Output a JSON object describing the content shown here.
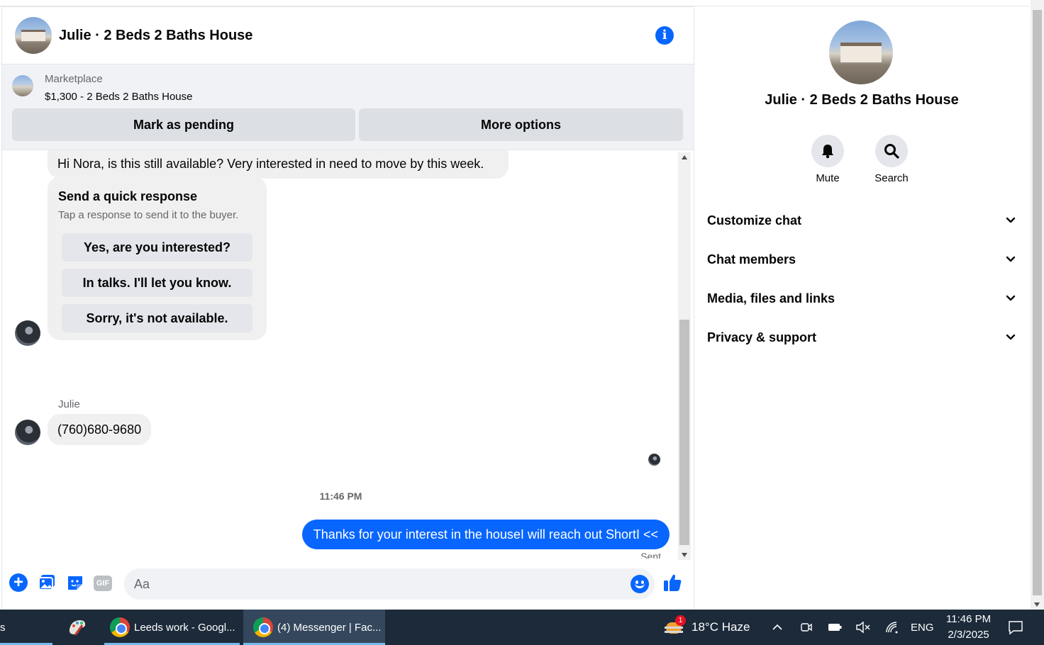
{
  "chat": {
    "title": "Julie · 2 Beds 2 Baths House",
    "marketplace_label": "Marketplace",
    "listing": "$1,300 - 2 Beds 2 Baths House",
    "mark_pending": "Mark as pending",
    "more_options": "More options"
  },
  "messages": {
    "first": "Hi Nora, is this still available? Very interested in need to move by this week.",
    "quick_title": "Send a quick response",
    "quick_sub": "Tap a response to send it to the buyer.",
    "quick_options": [
      "Yes, are you interested?",
      "In talks. I'll let you know.",
      "Sorry, it's not available."
    ],
    "sender": "Julie",
    "phone": "(760)680-9680",
    "timestamp": "11:46 PM",
    "sent_text": "Thanks for your interest in the houseI will reach out ShortI <<",
    "sent_status": "Sent"
  },
  "composer": {
    "placeholder": "Aa",
    "gif": "GIF"
  },
  "side": {
    "title": "Julie · 2 Beds 2 Baths House",
    "mute": "Mute",
    "search": "Search",
    "sections": [
      "Customize chat",
      "Chat members",
      "Media, files and links",
      "Privacy & support"
    ]
  },
  "taskbar": {
    "partial_label": "s",
    "leeds_label": "Leeds work - Googl...",
    "messenger_label": "(4) Messenger | Fac...",
    "weather_badge": "1",
    "weather": "18°C  Haze",
    "lang": "ENG",
    "time": "11:46 PM",
    "date": "2/3/2025"
  },
  "colors": {
    "accent": "#0866ff",
    "bubble_grey": "#f0f0f0",
    "taskbar": "#1c2a3a"
  }
}
